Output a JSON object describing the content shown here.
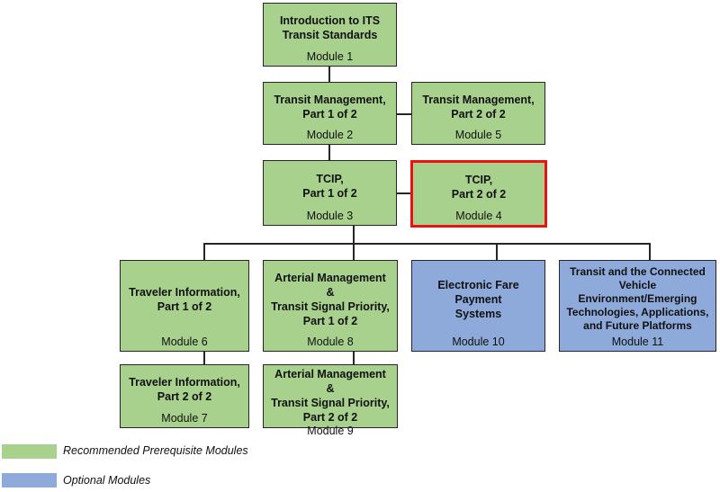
{
  "colors": {
    "recommended": "#a9d18e",
    "optional": "#8eaadb",
    "highlight_border": "#ee1111",
    "line": "#262626"
  },
  "modules": {
    "m1": {
      "title": "Introduction to ITS\nTransit Standards",
      "module": "Module 1",
      "type": "recommended"
    },
    "m2": {
      "title": "Transit Management,\nPart 1 of 2",
      "module": "Module 2",
      "type": "recommended"
    },
    "m5": {
      "title": "Transit Management,\nPart 2 of 2",
      "module": "Module 5",
      "type": "recommended"
    },
    "m3": {
      "title": "TCIP,\nPart 1 of 2",
      "module": "Module 3",
      "type": "recommended"
    },
    "m4": {
      "title": "TCIP,\nPart 2 of 2",
      "module": "Module 4",
      "type": "recommended",
      "highlighted": true
    },
    "m6": {
      "title": "Traveler Information,\nPart 1 of 2",
      "module": "Module 6",
      "type": "recommended"
    },
    "m8": {
      "title": "Arterial Management &\nTransit Signal Priority,\nPart 1 of 2",
      "module": "Module 8",
      "type": "recommended"
    },
    "m10": {
      "title": "Electronic Fare Payment\nSystems",
      "module": "Module 10",
      "type": "optional"
    },
    "m11": {
      "title": "Transit and the Connected\nVehicle\nEnvironment/Emerging\nTechnologies, Applications,\nand Future Platforms",
      "module": "Module 11",
      "type": "optional"
    },
    "m7": {
      "title": "Traveler Information,\nPart 2 of 2",
      "module": "Module 7",
      "type": "recommended"
    },
    "m9": {
      "title": "Arterial Management &\nTransit Signal Priority,\nPart 2 of 2",
      "module": "Module 9",
      "type": "recommended"
    }
  },
  "connections": [
    [
      "m1",
      "m2"
    ],
    [
      "m2",
      "m5"
    ],
    [
      "m2",
      "m3"
    ],
    [
      "m3",
      "m4"
    ],
    [
      "m3",
      "m6"
    ],
    [
      "m3",
      "m8"
    ],
    [
      "m3",
      "m10"
    ],
    [
      "m3",
      "m11"
    ],
    [
      "m6",
      "m7"
    ],
    [
      "m8",
      "m9"
    ]
  ],
  "legend": {
    "recommended": "Recommended Prerequisite Modules",
    "optional": "Optional Modules"
  }
}
